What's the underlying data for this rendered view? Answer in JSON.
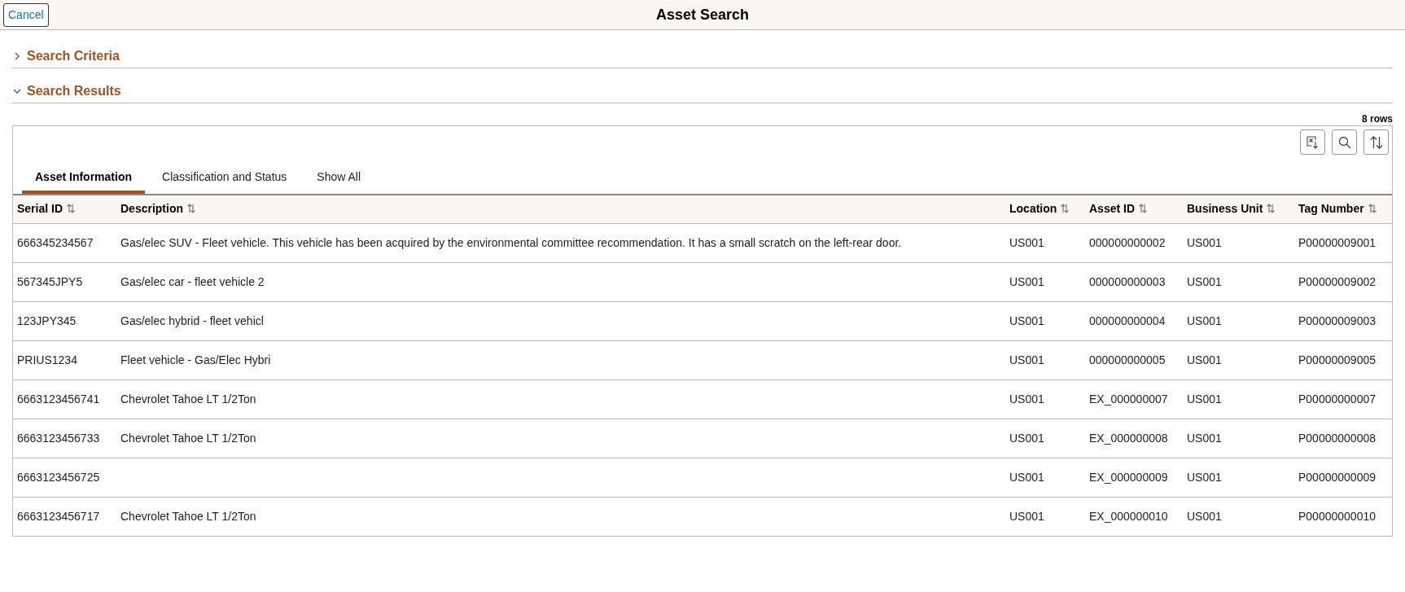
{
  "header": {
    "cancel_button": "Cancel",
    "title": "Asset Search"
  },
  "sections": [
    {
      "title": "Search Criteria",
      "expanded": false
    },
    {
      "title": "Search Results",
      "expanded": true
    }
  ],
  "grid": {
    "row_count": "8 rows",
    "tabs": [
      {
        "label": "Asset Information",
        "selected": true
      },
      {
        "label": "Classification and Status",
        "selected": false
      },
      {
        "label": "Show All",
        "selected": false
      }
    ],
    "columns": [
      "Serial ID",
      "Description",
      "Location",
      "Asset ID",
      "Business Unit",
      "Tag Number"
    ],
    "rows": [
      [
        "666345234567",
        "Gas/elec SUV - Fleet vehicle. This vehicle has been acquired by the environmental committee recommendation. It has a small scratch on the left-rear door.",
        "US001",
        "000000000002",
        "US001",
        "P00000009001"
      ],
      [
        "567345JPY5",
        "Gas/elec car - fleet vehicle 2",
        "US001",
        "000000000003",
        "US001",
        "P00000009002"
      ],
      [
        "123JPY345",
        "Gas/elec hybrid - fleet vehicl",
        "US001",
        "000000000004",
        "US001",
        "P00000009003"
      ],
      [
        "PRIUS1234",
        "Fleet vehicle - Gas/Elec Hybri",
        "US001",
        "000000000005",
        "US001",
        "P00000009005"
      ],
      [
        "6663123456741",
        "Chevrolet Tahoe LT 1/2Ton",
        "US001",
        "EX_000000007",
        "US001",
        "P00000000007"
      ],
      [
        "6663123456733",
        "Chevrolet Tahoe LT 1/2Ton",
        "US001",
        "EX_000000008",
        "US001",
        "P00000000008"
      ],
      [
        "6663123456725",
        null,
        "US001",
        "EX_000000009",
        "US001",
        "P00000000009"
      ],
      [
        "6663123456717",
        "Chevrolet Tahoe LT 1/2Ton",
        "US001",
        "EX_000000010",
        "US001",
        "P00000000010"
      ]
    ]
  }
}
